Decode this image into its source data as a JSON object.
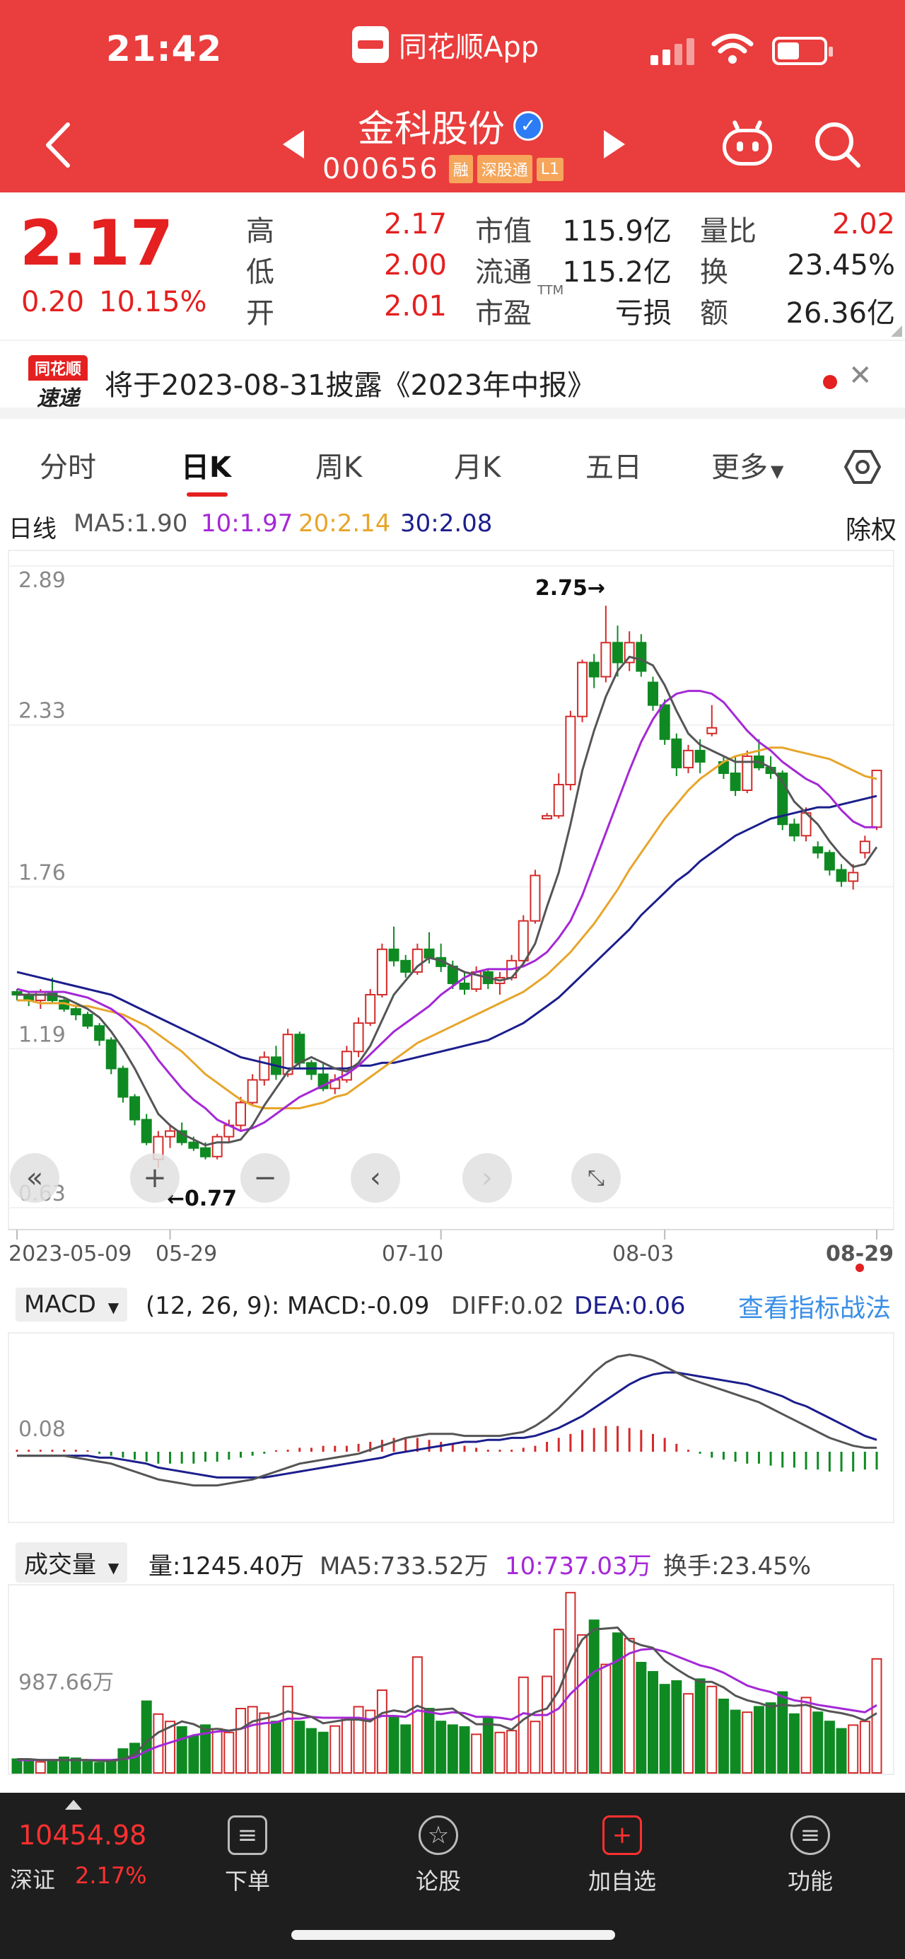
{
  "status_bar": {
    "time": "21:42",
    "app_name": "同花顺App"
  },
  "header": {
    "stock_name": "金科股份",
    "stock_code": "000656",
    "tags": [
      "融",
      "深股通",
      "L1"
    ]
  },
  "quote": {
    "price": "2.17",
    "change": "0.20",
    "change_pct": "10.15%",
    "fields": [
      {
        "label": "高",
        "value": "2.17",
        "color": "#e42020"
      },
      {
        "label": "市值",
        "value": "115.9亿",
        "color": "#222"
      },
      {
        "label": "量比",
        "value": "2.02",
        "color": "#e42020"
      },
      {
        "label": "低",
        "value": "2.00",
        "color": "#e42020"
      },
      {
        "label": "流通",
        "value": "115.2亿",
        "color": "#222"
      },
      {
        "label": "换",
        "value": "23.45%",
        "color": "#222"
      },
      {
        "label": "开",
        "value": "2.01",
        "color": "#e42020"
      },
      {
        "label": "市盈",
        "value": "亏损",
        "color": "#222"
      },
      {
        "label": "额",
        "value": "26.36亿",
        "color": "#222"
      }
    ],
    "pe_suffix": "TTM"
  },
  "notice": {
    "badge_top": "同花顺",
    "badge_bottom": "速递",
    "text": "将于2023-08-31披露《2023年中报》"
  },
  "tabs": [
    "分时",
    "日K",
    "周K",
    "月K",
    "五日",
    "更多"
  ],
  "active_tab": "日K",
  "ma_legend": {
    "period": "日线",
    "ma5": "MA5:1.90",
    "ma10": "10:1.97",
    "ma20": "20:2.14",
    "ma30": "30:2.08",
    "right_label": "除权"
  },
  "kline": {
    "y_ticks": [
      "2.89",
      "2.33",
      "1.76",
      "1.19",
      "0.63"
    ],
    "x_ticks": [
      "2023-05-09",
      "05-29",
      "07-10",
      "08-03",
      "08-29"
    ],
    "high_label": "2.75→",
    "low_label": "←0.77"
  },
  "macd_head": {
    "name": "MACD",
    "params": "(12, 26, 9):",
    "macd": "MACD:-0.09",
    "diff": "DIFF:0.02",
    "dea": "DEA:0.06",
    "link": "查看指标战法"
  },
  "macd_chart": {
    "tick": "0.08"
  },
  "vol_head": {
    "name": "成交量",
    "vol": "量:1245.40万",
    "ma5": "MA5:733.52万",
    "ma10": "10:737.03万",
    "turnover": "换手:23.45%"
  },
  "vol_chart": {
    "tick": "987.66万"
  },
  "chart_data": {
    "type": "candlestick",
    "title": "",
    "ylim": [
      0.63,
      2.89
    ],
    "x_start": "2023-05-09",
    "x_end": "08-29",
    "high_marker": 2.75,
    "low_marker": 0.77,
    "ohlc": [
      [
        1.39,
        1.4,
        1.36,
        1.38
      ],
      [
        1.38,
        1.39,
        1.34,
        1.36
      ],
      [
        1.36,
        1.4,
        1.33,
        1.39
      ],
      [
        1.39,
        1.44,
        1.35,
        1.36
      ],
      [
        1.36,
        1.37,
        1.32,
        1.33
      ],
      [
        1.33,
        1.34,
        1.29,
        1.31
      ],
      [
        1.31,
        1.32,
        1.26,
        1.27
      ],
      [
        1.27,
        1.28,
        1.2,
        1.22
      ],
      [
        1.22,
        1.23,
        1.1,
        1.12
      ],
      [
        1.12,
        1.13,
        1.0,
        1.02
      ],
      [
        1.02,
        1.03,
        0.92,
        0.94
      ],
      [
        0.94,
        0.96,
        0.85,
        0.86
      ],
      [
        0.8,
        0.9,
        0.77,
        0.88
      ],
      [
        0.88,
        0.92,
        0.84,
        0.9
      ],
      [
        0.9,
        0.93,
        0.85,
        0.86
      ],
      [
        0.86,
        0.88,
        0.83,
        0.84
      ],
      [
        0.84,
        0.86,
        0.8,
        0.81
      ],
      [
        0.81,
        0.89,
        0.8,
        0.88
      ],
      [
        0.88,
        0.94,
        0.86,
        0.92
      ],
      [
        0.92,
        1.02,
        0.9,
        1.0
      ],
      [
        1.0,
        1.1,
        0.99,
        1.08
      ],
      [
        1.08,
        1.18,
        1.06,
        1.16
      ],
      [
        1.16,
        1.2,
        1.08,
        1.1
      ],
      [
        1.1,
        1.26,
        1.09,
        1.24
      ],
      [
        1.24,
        1.25,
        1.12,
        1.14
      ],
      [
        1.14,
        1.15,
        1.08,
        1.1
      ],
      [
        1.1,
        1.14,
        1.04,
        1.05
      ],
      [
        1.05,
        1.1,
        1.03,
        1.08
      ],
      [
        1.08,
        1.2,
        1.07,
        1.18
      ],
      [
        1.18,
        1.3,
        1.16,
        1.28
      ],
      [
        1.28,
        1.4,
        1.27,
        1.38
      ],
      [
        1.38,
        1.56,
        1.37,
        1.54
      ],
      [
        1.54,
        1.62,
        1.48,
        1.5
      ],
      [
        1.5,
        1.52,
        1.44,
        1.46
      ],
      [
        1.46,
        1.56,
        1.45,
        1.54
      ],
      [
        1.54,
        1.6,
        1.49,
        1.51
      ],
      [
        1.51,
        1.56,
        1.46,
        1.48
      ],
      [
        1.48,
        1.5,
        1.4,
        1.42
      ],
      [
        1.42,
        1.46,
        1.38,
        1.4
      ],
      [
        1.4,
        1.48,
        1.39,
        1.46
      ],
      [
        1.46,
        1.47,
        1.4,
        1.42
      ],
      [
        1.42,
        1.46,
        1.38,
        1.44
      ],
      [
        1.44,
        1.52,
        1.43,
        1.5
      ],
      [
        1.5,
        1.66,
        1.49,
        1.64
      ],
      [
        1.64,
        1.82,
        1.63,
        1.8
      ],
      [
        2.0,
        2.02,
        2.0,
        2.01
      ],
      [
        2.01,
        2.16,
        2.0,
        2.12
      ],
      [
        2.12,
        2.38,
        2.1,
        2.36
      ],
      [
        2.36,
        2.56,
        2.34,
        2.55
      ],
      [
        2.55,
        2.58,
        2.46,
        2.5
      ],
      [
        2.5,
        2.75,
        2.48,
        2.62
      ],
      [
        2.62,
        2.68,
        2.5,
        2.55
      ],
      [
        2.55,
        2.66,
        2.52,
        2.62
      ],
      [
        2.62,
        2.65,
        2.5,
        2.52
      ],
      [
        2.48,
        2.5,
        2.38,
        2.4
      ],
      [
        2.4,
        2.42,
        2.26,
        2.28
      ],
      [
        2.28,
        2.3,
        2.15,
        2.18
      ],
      [
        2.18,
        2.26,
        2.16,
        2.24
      ],
      [
        2.24,
        2.28,
        2.16,
        2.2
      ],
      [
        2.3,
        2.4,
        2.29,
        2.32
      ],
      [
        2.2,
        2.22,
        2.14,
        2.16
      ],
      [
        2.16,
        2.22,
        2.08,
        2.1
      ],
      [
        2.1,
        2.24,
        2.09,
        2.22
      ],
      [
        2.22,
        2.28,
        2.17,
        2.18
      ],
      [
        2.18,
        2.22,
        2.14,
        2.16
      ],
      [
        2.16,
        2.17,
        1.96,
        1.98
      ],
      [
        1.98,
        2.0,
        1.92,
        1.94
      ],
      [
        1.94,
        2.04,
        1.92,
        2.02
      ],
      [
        1.9,
        1.92,
        1.86,
        1.88
      ],
      [
        1.88,
        1.89,
        1.8,
        1.82
      ],
      [
        1.82,
        1.84,
        1.76,
        1.78
      ],
      [
        1.78,
        1.84,
        1.75,
        1.81
      ],
      [
        1.88,
        1.94,
        1.86,
        1.92
      ],
      [
        1.97,
        2.17,
        1.96,
        2.17
      ]
    ],
    "ma5": [
      1.38,
      1.38,
      1.38,
      1.38,
      1.37,
      1.35,
      1.33,
      1.3,
      1.25,
      1.19,
      1.12,
      1.04,
      0.96,
      0.92,
      0.89,
      0.87,
      0.85,
      0.86,
      0.86,
      0.87,
      0.92,
      0.99,
      1.05,
      1.11,
      1.14,
      1.16,
      1.14,
      1.12,
      1.11,
      1.14,
      1.2,
      1.29,
      1.38,
      1.43,
      1.48,
      1.51,
      1.5,
      1.48,
      1.46,
      1.45,
      1.44,
      1.43,
      1.44,
      1.49,
      1.56,
      1.69,
      1.81,
      1.98,
      2.17,
      2.31,
      2.43,
      2.52,
      2.57,
      2.56,
      2.54,
      2.47,
      2.38,
      2.3,
      2.26,
      2.24,
      2.22,
      2.2,
      2.2,
      2.2,
      2.18,
      2.13,
      2.06,
      2.02,
      1.98,
      1.92,
      1.87,
      1.83,
      1.84,
      1.9
    ],
    "ma10": [
      1.4,
      1.39,
      1.39,
      1.39,
      1.39,
      1.38,
      1.37,
      1.35,
      1.33,
      1.3,
      1.26,
      1.21,
      1.15,
      1.1,
      1.05,
      1.01,
      0.98,
      0.94,
      0.92,
      0.9,
      0.91,
      0.93,
      0.96,
      0.99,
      1.02,
      1.04,
      1.06,
      1.08,
      1.1,
      1.13,
      1.17,
      1.21,
      1.25,
      1.28,
      1.31,
      1.34,
      1.38,
      1.41,
      1.44,
      1.46,
      1.47,
      1.47,
      1.47,
      1.48,
      1.5,
      1.53,
      1.58,
      1.64,
      1.73,
      1.84,
      1.95,
      2.06,
      2.17,
      2.27,
      2.35,
      2.41,
      2.44,
      2.45,
      2.45,
      2.44,
      2.41,
      2.36,
      2.31,
      2.27,
      2.24,
      2.2,
      2.17,
      2.14,
      2.12,
      2.08,
      2.03,
      1.99,
      1.97,
      1.97
    ],
    "ma20": [
      1.36,
      1.36,
      1.35,
      1.35,
      1.35,
      1.34,
      1.34,
      1.33,
      1.32,
      1.31,
      1.29,
      1.27,
      1.24,
      1.21,
      1.18,
      1.14,
      1.1,
      1.07,
      1.04,
      1.01,
      0.99,
      0.98,
      0.98,
      0.98,
      0.98,
      0.99,
      1.0,
      1.02,
      1.03,
      1.06,
      1.09,
      1.12,
      1.15,
      1.18,
      1.21,
      1.23,
      1.25,
      1.27,
      1.29,
      1.31,
      1.33,
      1.35,
      1.37,
      1.39,
      1.42,
      1.45,
      1.49,
      1.53,
      1.58,
      1.63,
      1.69,
      1.75,
      1.82,
      1.88,
      1.94,
      2.0,
      2.05,
      2.1,
      2.14,
      2.17,
      2.2,
      2.22,
      2.23,
      2.24,
      2.25,
      2.25,
      2.24,
      2.23,
      2.22,
      2.21,
      2.19,
      2.17,
      2.15,
      2.14
    ],
    "ma30": [
      1.46,
      1.45,
      1.44,
      1.43,
      1.42,
      1.41,
      1.4,
      1.39,
      1.38,
      1.36,
      1.34,
      1.32,
      1.3,
      1.28,
      1.26,
      1.24,
      1.22,
      1.2,
      1.18,
      1.16,
      1.15,
      1.14,
      1.13,
      1.12,
      1.12,
      1.12,
      1.12,
      1.12,
      1.12,
      1.13,
      1.13,
      1.14,
      1.14,
      1.15,
      1.16,
      1.17,
      1.18,
      1.19,
      1.2,
      1.21,
      1.22,
      1.24,
      1.26,
      1.28,
      1.31,
      1.34,
      1.37,
      1.41,
      1.45,
      1.49,
      1.53,
      1.57,
      1.61,
      1.66,
      1.7,
      1.74,
      1.78,
      1.81,
      1.85,
      1.88,
      1.91,
      1.94,
      1.96,
      1.98,
      2.0,
      2.01,
      2.02,
      2.03,
      2.04,
      2.04,
      2.05,
      2.06,
      2.07,
      2.08
    ],
    "macd_hist": [
      0.01,
      0.01,
      0.01,
      0.01,
      0.01,
      0.01,
      0.0,
      -0.01,
      -0.02,
      -0.03,
      -0.04,
      -0.05,
      -0.06,
      -0.06,
      -0.06,
      -0.06,
      -0.05,
      -0.05,
      -0.04,
      -0.03,
      -0.02,
      -0.01,
      0.0,
      0.01,
      0.02,
      0.02,
      0.03,
      0.03,
      0.03,
      0.04,
      0.05,
      0.06,
      0.07,
      0.07,
      0.07,
      0.06,
      0.05,
      0.04,
      0.03,
      0.02,
      0.01,
      0.01,
      0.01,
      0.02,
      0.03,
      0.05,
      0.07,
      0.09,
      0.11,
      0.12,
      0.13,
      0.13,
      0.12,
      0.11,
      0.09,
      0.07,
      0.04,
      0.01,
      -0.01,
      -0.03,
      -0.04,
      -0.05,
      -0.06,
      -0.06,
      -0.07,
      -0.08,
      -0.08,
      -0.09,
      -0.09,
      -0.1,
      -0.1,
      -0.1,
      -0.09,
      -0.09
    ],
    "diff": [
      -0.02,
      -0.02,
      -0.02,
      -0.02,
      -0.02,
      -0.03,
      -0.04,
      -0.05,
      -0.06,
      -0.08,
      -0.1,
      -0.12,
      -0.14,
      -0.15,
      -0.16,
      -0.17,
      -0.17,
      -0.17,
      -0.16,
      -0.15,
      -0.14,
      -0.12,
      -0.1,
      -0.08,
      -0.06,
      -0.05,
      -0.04,
      -0.03,
      -0.02,
      -0.01,
      0.01,
      0.03,
      0.05,
      0.07,
      0.08,
      0.09,
      0.09,
      0.09,
      0.08,
      0.08,
      0.08,
      0.08,
      0.09,
      0.1,
      0.13,
      0.17,
      0.22,
      0.28,
      0.34,
      0.4,
      0.45,
      0.48,
      0.49,
      0.48,
      0.46,
      0.43,
      0.4,
      0.37,
      0.35,
      0.33,
      0.31,
      0.29,
      0.27,
      0.25,
      0.22,
      0.19,
      0.16,
      0.13,
      0.1,
      0.07,
      0.05,
      0.03,
      0.02,
      0.02
    ],
    "dea": [
      -0.02,
      -0.02,
      -0.02,
      -0.02,
      -0.02,
      -0.02,
      -0.02,
      -0.03,
      -0.03,
      -0.04,
      -0.05,
      -0.06,
      -0.08,
      -0.09,
      -0.1,
      -0.11,
      -0.12,
      -0.13,
      -0.13,
      -0.13,
      -0.13,
      -0.13,
      -0.12,
      -0.11,
      -0.1,
      -0.09,
      -0.08,
      -0.07,
      -0.06,
      -0.05,
      -0.04,
      -0.03,
      -0.01,
      0.0,
      0.01,
      0.02,
      0.03,
      0.04,
      0.05,
      0.05,
      0.06,
      0.06,
      0.07,
      0.07,
      0.08,
      0.1,
      0.12,
      0.15,
      0.18,
      0.22,
      0.26,
      0.3,
      0.34,
      0.37,
      0.39,
      0.4,
      0.4,
      0.39,
      0.38,
      0.37,
      0.36,
      0.35,
      0.34,
      0.32,
      0.3,
      0.28,
      0.25,
      0.23,
      0.2,
      0.17,
      0.14,
      0.11,
      0.08,
      0.06
    ],
    "volume_wan": [
      150,
      140,
      120,
      130,
      170,
      160,
      120,
      110,
      130,
      260,
      320,
      780,
      640,
      560,
      500,
      400,
      520,
      480,
      440,
      700,
      720,
      650,
      560,
      940,
      560,
      480,
      440,
      510,
      600,
      720,
      680,
      900,
      620,
      520,
      1260,
      700,
      560,
      520,
      500,
      420,
      600,
      440,
      460,
      1040,
      560,
      1050,
      1560,
      1960,
      1500,
      1660,
      1180,
      1520,
      1460,
      1200,
      1100,
      960,
      1000,
      860,
      1020,
      940,
      800,
      680,
      660,
      720,
      760,
      880,
      640,
      820,
      660,
      560,
      480,
      520,
      560,
      1240
    ],
    "vol_ma5": [
      150,
      150,
      140,
      140,
      140,
      140,
      140,
      130,
      130,
      150,
      200,
      340,
      440,
      500,
      560,
      530,
      470,
      480,
      460,
      480,
      560,
      590,
      620,
      670,
      640,
      610,
      540,
      560,
      580,
      580,
      560,
      650,
      680,
      660,
      730,
      680,
      690,
      700,
      610,
      530,
      530,
      520,
      470,
      580,
      660,
      700,
      890,
      1220,
      1450,
      1560,
      1570,
      1580,
      1440,
      1390,
      1360,
      1220,
      1130,
      1050,
      990,
      990,
      930,
      840,
      790,
      760,
      720,
      740,
      730,
      740,
      700,
      670,
      650,
      620,
      570,
      650
    ],
    "vol_ma10": [
      140,
      140,
      140,
      140,
      140,
      140,
      140,
      140,
      140,
      150,
      170,
      240,
      290,
      330,
      370,
      410,
      430,
      450,
      460,
      480,
      520,
      540,
      550,
      590,
      590,
      610,
      600,
      600,
      600,
      600,
      580,
      620,
      620,
      610,
      680,
      660,
      640,
      660,
      650,
      610,
      610,
      600,
      580,
      650,
      630,
      630,
      700,
      860,
      980,
      1100,
      1160,
      1220,
      1300,
      1340,
      1350,
      1320,
      1270,
      1220,
      1170,
      1140,
      1090,
      1020,
      950,
      910,
      880,
      830,
      790,
      770,
      740,
      720,
      700,
      680,
      660,
      737
    ]
  }
}
